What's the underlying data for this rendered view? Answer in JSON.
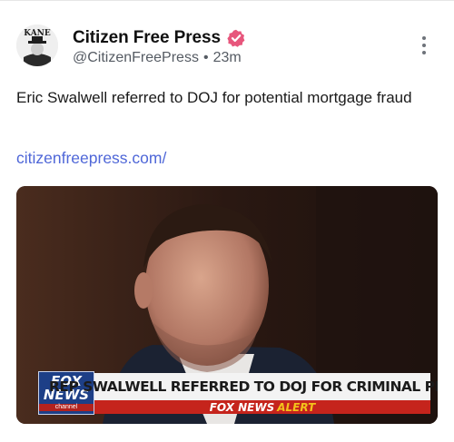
{
  "author": {
    "display_name": "Citizen Free Press",
    "handle": "@CitizenFreePress",
    "separator": "•",
    "time_ago": "23m",
    "avatar_text": "KANE"
  },
  "post": {
    "text": "Eric Swalwell referred to DOJ for potential mortgage fraud",
    "link_text": "citizenfreepress.com/"
  },
  "media": {
    "network_logo_line1": "FOX",
    "network_logo_line2": "NEWS",
    "network_logo_line3": "channel",
    "chyron": "REP SWALWELL REFERRED TO DOJ FOR CRIMINAL PROBE",
    "alert_prefix": "FOX NEWS",
    "alert_word": "ALERT"
  },
  "colors": {
    "verified_badge": "#e7567c",
    "link": "#4f67d8",
    "chyron_alert_bar": "#c5241c",
    "alert_word": "#f3c21b"
  },
  "icons": {
    "verified": "verified-badge-icon",
    "more": "more-vertical-icon"
  }
}
